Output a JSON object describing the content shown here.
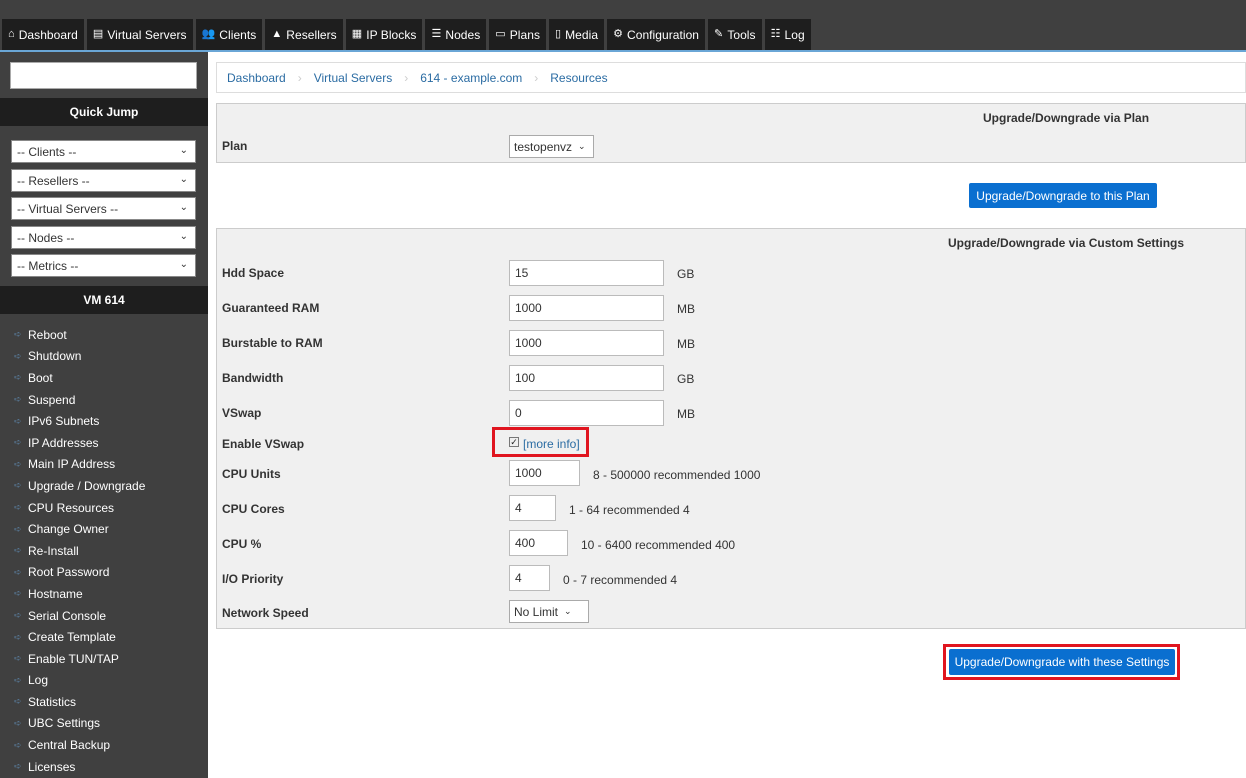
{
  "nav": {
    "tabs": [
      {
        "label": "Dashboard",
        "icon": "home-icon",
        "glyph": "⌂"
      },
      {
        "label": "Virtual Servers",
        "icon": "server-list-icon",
        "glyph": "▤"
      },
      {
        "label": "Clients",
        "icon": "users-icon",
        "glyph": "👥"
      },
      {
        "label": "Resellers",
        "icon": "user-icon",
        "glyph": "▲"
      },
      {
        "label": "IP Blocks",
        "icon": "grid-icon",
        "glyph": "▦"
      },
      {
        "label": "Nodes",
        "icon": "list-icon",
        "glyph": "☰"
      },
      {
        "label": "Plans",
        "icon": "card-icon",
        "glyph": "▭"
      },
      {
        "label": "Media",
        "icon": "file-icon",
        "glyph": "▯"
      },
      {
        "label": "Configuration",
        "icon": "gear-icon",
        "glyph": "⚙"
      },
      {
        "label": "Tools",
        "icon": "wrench-icon",
        "glyph": "✎"
      },
      {
        "label": "Log",
        "icon": "table-icon",
        "glyph": "☷"
      }
    ]
  },
  "sidebar": {
    "search_value": "",
    "quick_jump_title": "Quick Jump",
    "selects": [
      "-- Clients --",
      "-- Resellers --",
      "-- Virtual Servers --",
      "-- Nodes --",
      "-- Metrics --"
    ],
    "vm_title": "VM 614",
    "menu": [
      "Reboot",
      "Shutdown",
      "Boot",
      "Suspend",
      "IPv6 Subnets",
      "IP Addresses",
      "Main IP Address",
      "Upgrade / Downgrade",
      "CPU Resources",
      "Change Owner",
      "Re-Install",
      "Root Password",
      "Hostname",
      "Serial Console",
      "Create Template",
      "Enable TUN/TAP",
      "Log",
      "Statistics",
      "UBC Settings",
      "Central Backup",
      "Licenses"
    ]
  },
  "breadcrumb": [
    "Dashboard",
    "Virtual Servers",
    "614 - example.com",
    "Resources"
  ],
  "plan_section": {
    "title": "Upgrade/Downgrade via Plan",
    "plan_label": "Plan",
    "plan_value": "testopenvz",
    "button": "Upgrade/Downgrade to this Plan"
  },
  "custom_section": {
    "title": "Upgrade/Downgrade via Custom Settings",
    "hdd_label": "Hdd Space",
    "hdd_value": "15",
    "hdd_unit": "GB",
    "ram_label": "Guaranteed RAM",
    "ram_value": "1000",
    "ram_unit": "MB",
    "burst_label": "Burstable to RAM",
    "burst_value": "1000",
    "burst_unit": "MB",
    "bw_label": "Bandwidth",
    "bw_value": "100",
    "bw_unit": "GB",
    "vswap_label": "VSwap",
    "vswap_value": "0",
    "vswap_unit": "MB",
    "enable_vswap_label": "Enable VSwap",
    "enable_vswap_checked": true,
    "more_info": "[more info]",
    "cpu_units_label": "CPU Units",
    "cpu_units_value": "1000",
    "cpu_units_hint": "8 - 500000 recommended 1000",
    "cpu_cores_label": "CPU Cores",
    "cpu_cores_value": "4",
    "cpu_cores_hint": "1 - 64 recommended 4",
    "cpu_pct_label": "CPU %",
    "cpu_pct_value": "400",
    "cpu_pct_hint": "10 - 6400 recommended 400",
    "io_label": "I/O Priority",
    "io_value": "4",
    "io_hint": "0 - 7 recommended 4",
    "net_label": "Network Speed",
    "net_value": "No Limit",
    "button": "Upgrade/Downgrade with these Settings"
  },
  "colors": {
    "accent": "#0a6fd0",
    "highlight": "#e0151f",
    "nav_bg": "#404040"
  }
}
